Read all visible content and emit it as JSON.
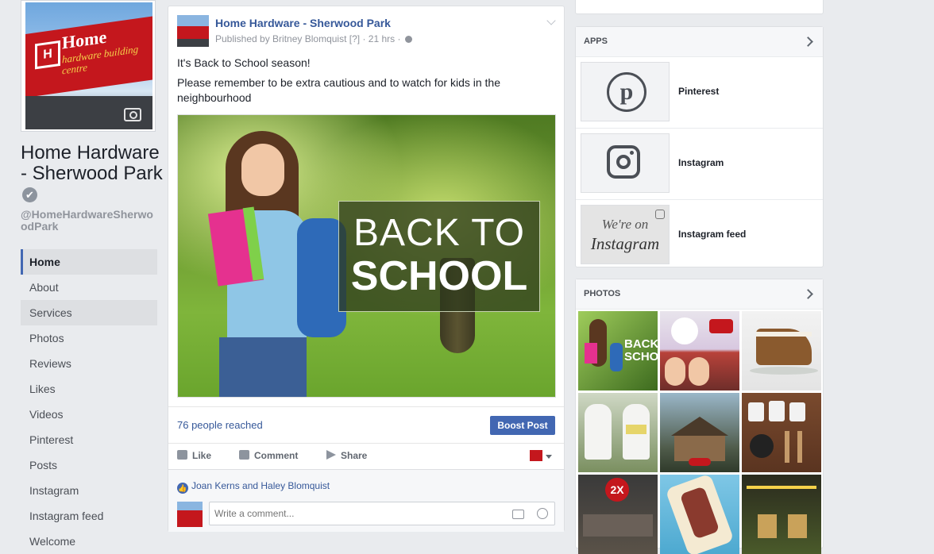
{
  "page": {
    "name": "Home Hardware - Sherwood Park",
    "handle": "@HomeHardwareSherwoodPark",
    "verified_glyph": "✔",
    "profile_logo_mark": "H",
    "profile_logo_text": "Home",
    "profile_logo_sub": "hardware building centre"
  },
  "nav": {
    "items": [
      {
        "label": "Home"
      },
      {
        "label": "About"
      },
      {
        "label": "Services"
      },
      {
        "label": "Photos"
      },
      {
        "label": "Reviews"
      },
      {
        "label": "Likes"
      },
      {
        "label": "Videos"
      },
      {
        "label": "Pinterest"
      },
      {
        "label": "Posts"
      },
      {
        "label": "Instagram"
      },
      {
        "label": "Instagram feed"
      },
      {
        "label": "Welcome"
      }
    ]
  },
  "post": {
    "author": "Home Hardware - Sherwood Park",
    "published_by": "Published by Britney Blomquist",
    "help_marker": "[?]",
    "time": "21 hrs",
    "line1": "It's Back to School season!",
    "line2": "Please remember to be extra cautious and to watch for kids in the neighbourhood",
    "image_line1": "BACK TO",
    "image_line2": "SCHOOL",
    "reach": "76 people reached",
    "boost_label": "Boost Post",
    "actions": {
      "like": "Like",
      "comment": "Comment",
      "share": "Share"
    },
    "likers": "Joan Kerns and Haley Blomquist",
    "comment_placeholder": "Write a comment..."
  },
  "sidebar": {
    "apps_title": "APPS",
    "apps": [
      {
        "label": "Pinterest",
        "icon": "pinterest-icon"
      },
      {
        "label": "Instagram",
        "icon": "instagram-icon"
      },
      {
        "label": "Instagram feed",
        "icon": "instagram-feed-thumbnail",
        "thumb_line1": "We're on",
        "thumb_line2": "Instagram"
      }
    ],
    "photos_title": "PHOTOS",
    "photo_badge_text": "BACK\nSCHO",
    "photo_2x_badge": "2X"
  },
  "colors": {
    "link": "#365899",
    "button": "#4267b2",
    "brand_red": "#c4171d",
    "background": "#e9ebee"
  }
}
